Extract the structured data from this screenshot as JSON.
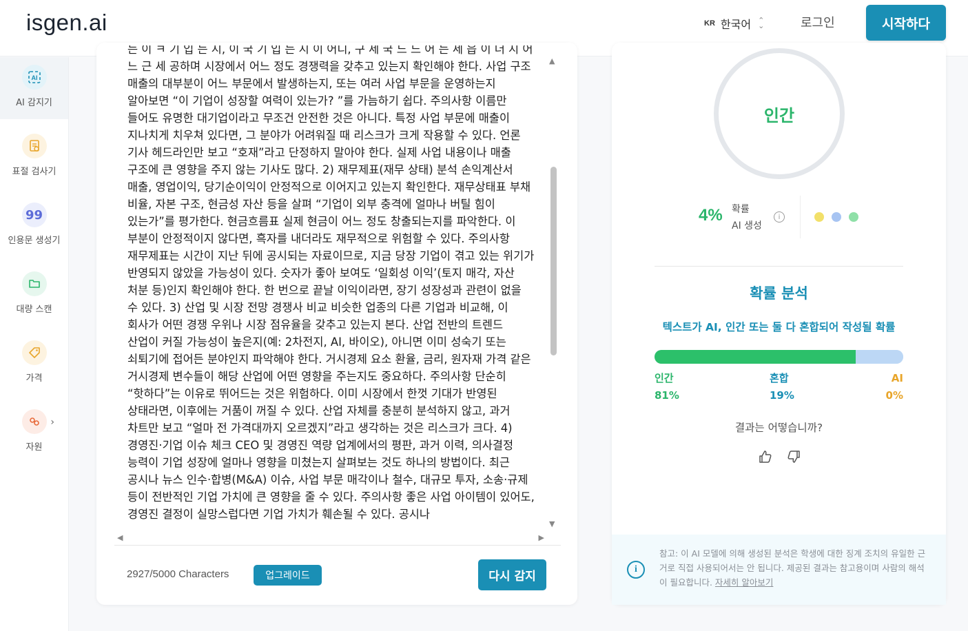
{
  "header": {
    "logo": "isgen.ai",
    "lang_code": "KR",
    "lang_label": "한국어",
    "login": "로그인",
    "start": "시작하다"
  },
  "sidebar": {
    "items": [
      {
        "label": "AI 감지기",
        "icon": "ai-detector-icon",
        "color": "#1a8fb5"
      },
      {
        "label": "표절 검사기",
        "icon": "plagiarism-icon",
        "color": "#e8a52a"
      },
      {
        "label": "인용문 생성기",
        "icon": "quote-icon",
        "color": "#5b6bd8"
      },
      {
        "label": "대량 스캔",
        "icon": "folder-icon",
        "color": "#2bb56b"
      },
      {
        "label": "가격",
        "icon": "price-tag-icon",
        "color": "#e8a52a"
      },
      {
        "label": "자원",
        "icon": "resources-icon",
        "color": "#e86a3a"
      }
    ]
  },
  "editor": {
    "text": "는 이 ㅋ 기 입 는 시, 이 국 기 입 는 시 이 어디, 구 세 국 느 느 어 는 세 읍 이 더 시 어 느 근 세 공하며 시장에서 어느 정도 경쟁력을 갖추고 있는지 확인해야 한다. 사업 구조 매출의 대부분이 어느 부문에서 발생하는지, 또는 여러 사업 부문을 운영하는지 알아보면 “이 기업이 성장할 여력이 있는가? ”를 가늠하기 쉽다. 주의사항 이름만 들어도 유명한 대기업이라고 무조건 안전한 것은 아니다. 특정 사업 부문에 매출이 지나치게 치우쳐 있다면, 그 분야가 어려워질 때 리스크가 크게 작용할 수 있다. 언론 기사 헤드라인만 보고 “호재”라고 단정하지 말아야 한다. 실제 사업 내용이나 매출 구조에 큰 영향을 주지 않는 기사도 많다. 2) 재무제표(재무 상태) 분석 손익계산서 매출, 영업이익, 당기순이익이 안정적으로 이어지고 있는지 확인한다. 재무상태표 부채 비율, 자본 구조, 현금성 자산 등을 살펴 “기업이 외부 충격에 얼마나 버틸 힘이 있는가”를 평가한다. 현금흐름표 실제 현금이 어느 정도 창출되는지를 파악한다. 이 부분이 안정적이지 않다면, 흑자를 내더라도 재무적으로 위험할 수 있다. 주의사항 재무제표는 시간이 지난 뒤에 공시되는 자료이므로, 지금 당장 기업이 겪고 있는 위기가 반영되지 않았을 가능성이 있다. 숫자가 좋아 보여도 ‘일회성 이익’(토지 매각, 자산 처분 등)인지 확인해야 한다. 한 번으로 끝날 이익이라면, 장기 성장성과 관련이 없을 수 있다. 3) 산업 및 시장 전망 경쟁사 비교 비슷한 업종의 다른 기업과 비교해, 이 회사가 어떤 경쟁 우위나 시장 점유율을 갖추고 있는지 본다. 산업 전반의 트렌드 산업이 커질 가능성이 높은지(예: 2차전지, AI, 바이오), 아니면 이미 성숙기 또는 쇠퇴기에 접어든 분야인지 파악해야 한다. 거시경제 요소 환율, 금리, 원자재 가격 같은 거시경제 변수들이 해당 산업에 어떤 영향을 주는지도 중요하다. 주의사항 단순히 “핫하다”는 이유로 뛰어드는 것은 위험하다. 이미 시장에서 한껏 기대가 반영된 상태라면, 이후에는 거품이 꺼질 수 있다. 산업 자체를 충분히 분석하지 않고, 과거 차트만 보고 “얼마 전 가격대까지 오르겠지”라고 생각하는 것은 리스크가 크다. 4) 경영진·기업 이슈 체크 CEO 및 경영진 역량 업계에서의 평판, 과거 이력, 의사결정 능력이 기업 성장에 얼마나 영향을 미쳤는지 살펴보는 것도 하나의 방법이다. 최근 공시나 뉴스 인수·합병(M&A) 이슈, 사업 부문 매각이나 철수, 대규모 투자, 소송·규제 등이 전반적인 기업 가치에 큰 영향을 줄 수 있다. 주의사항 좋은 사업 아이템이 있어도, 경영진 결정이 실망스럽다면 기업 가치가 훼손될 수 있다. 공시나",
    "char_count": "2927/5000 Characters",
    "upgrade": "업그레이드",
    "redetect": "다시 감지"
  },
  "result": {
    "ring_label": "인간",
    "ai_prob": "4%",
    "ai_prob_label_1": "확률",
    "ai_prob_label_2": "AI 생성",
    "dots": [
      "#f2e06a",
      "#a7c4f2",
      "#8fe0a8"
    ],
    "analysis_title": "확률 분석",
    "analysis_sub": "텍스트가 AI, 인간 또는 둘 다 혼합되어 작성될 확률",
    "human_fraction": 0.81,
    "mixed_fraction": 0.19,
    "ai_fraction": 0,
    "human_label": "인간",
    "human_value": "81%",
    "mixed_label": "혼합",
    "mixed_value": "19%",
    "ai_label": "AI",
    "ai_value": "0%",
    "colors": {
      "human": "#2cc06a",
      "mixed": "#1a8fb5",
      "ai": "#e8a52a"
    },
    "question": "결과는 어떻습니까?",
    "note_text": "참고: 이 AI 모델에 의해 생성된 분석은 학생에 대한 징계 조치의 유일한 근거로 직접 사용되어서는 안 됩니다. 제공된 결과는 참고용이며 사람의 해석이 필요합니다. ",
    "note_link": "자세히 알아보기"
  }
}
